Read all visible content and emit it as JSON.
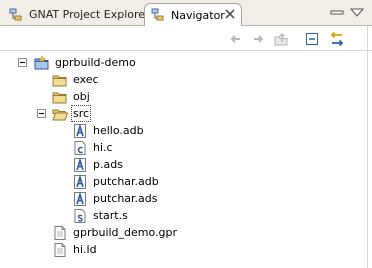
{
  "tabs": [
    {
      "label": "GNAT Project Explorer",
      "icon": "gnat-project-explorer-icon",
      "active": false
    },
    {
      "label": "Navigator",
      "icon": "navigator-icon",
      "active": true
    }
  ],
  "toolbar": {
    "buttons": [
      "back-arrow-icon",
      "forward-arrow-icon",
      "up-folder-icon",
      "collapse-all-icon",
      "link-with-editor-icon"
    ]
  },
  "tree": {
    "project": {
      "label": "gprbuild-demo",
      "expanded": true
    },
    "folders": {
      "exec": "exec",
      "obj": "obj",
      "src": "src"
    },
    "src_files": [
      "hello.adb",
      "hi.c",
      "p.ads",
      "putchar.adb",
      "putchar.ads",
      "start.s"
    ],
    "root_files": [
      "gprbuild_demo.gpr",
      "hi.ld"
    ]
  },
  "colors": {
    "accent": "#2f5ea8",
    "folder": "#e6c870",
    "tab_bg": "#f0eee6"
  }
}
